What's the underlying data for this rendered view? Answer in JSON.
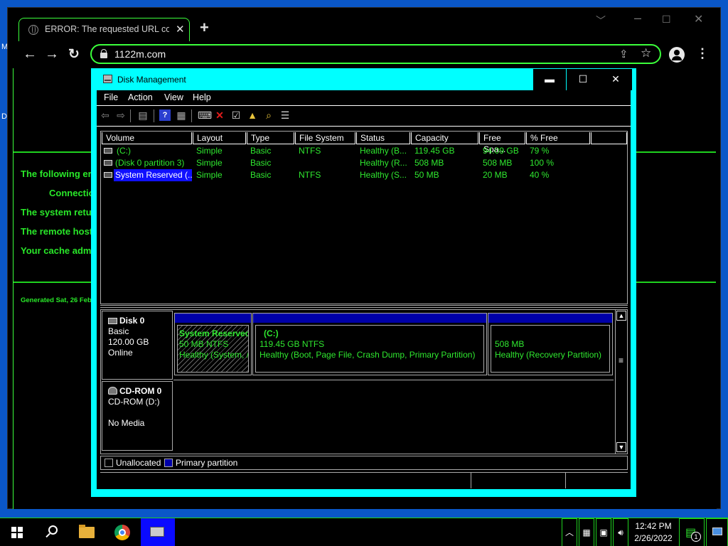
{
  "desktop": {
    "left_letters": [
      "M",
      "D"
    ]
  },
  "browser": {
    "tab_title": "ERROR: The requested URL could not be retrieved",
    "new_tab": "+",
    "url": "1122m.com",
    "page": {
      "lines": [
        "The following err",
        "Connectio",
        "The system retur",
        "The remote host",
        "Your cache admi"
      ],
      "generated": "Generated Sat, 26 Feb"
    }
  },
  "disk_mgmt": {
    "title": "Disk Management",
    "menu": [
      "File",
      "Action",
      "View",
      "Help"
    ],
    "columns": [
      "Volume",
      "Layout",
      "Type",
      "File System",
      "Status",
      "Capacity",
      "Free Spa...",
      "% Free"
    ],
    "volumes": [
      [
        "(C:)",
        "Simple",
        "Basic",
        "NTFS",
        "Healthy (B...",
        "119.45 GB",
        "94.09 GB",
        "79 %"
      ],
      [
        "(Disk 0 partition 3)",
        "Simple",
        "Basic",
        "",
        "Healthy (R...",
        "508 MB",
        "508 MB",
        "100 %"
      ],
      [
        "System Reserved (...",
        "Simple",
        "Basic",
        "NTFS",
        "Healthy (S...",
        "50 MB",
        "20 MB",
        "40 %"
      ]
    ],
    "disk0": {
      "name": "Disk 0",
      "type": "Basic",
      "size": "120.00 GB",
      "state": "Online",
      "partitions": [
        {
          "name": "System Reservec",
          "size": "50 MB NTFS",
          "status": "Healthy (System, /"
        },
        {
          "name": "(C:)",
          "size": "119.45 GB NTFS",
          "status": "Healthy (Boot, Page File, Crash Dump, Primary Partition)"
        },
        {
          "name": "",
          "size": "508 MB",
          "status": "Healthy (Recovery Partition)"
        }
      ]
    },
    "cdrom": {
      "name": "CD-ROM 0",
      "drive": "CD-ROM (D:)",
      "media": "No Media"
    },
    "legend": [
      "Unallocated",
      "Primary partition"
    ],
    "colors": {
      "primary_partition": "#0000a8",
      "selection": "#1010ff",
      "text_green": "#2fe82f",
      "frame": "#00ffff"
    }
  },
  "taskbar": {
    "time": "12:42 PM",
    "date": "2/26/2022",
    "notification_count": "1"
  }
}
